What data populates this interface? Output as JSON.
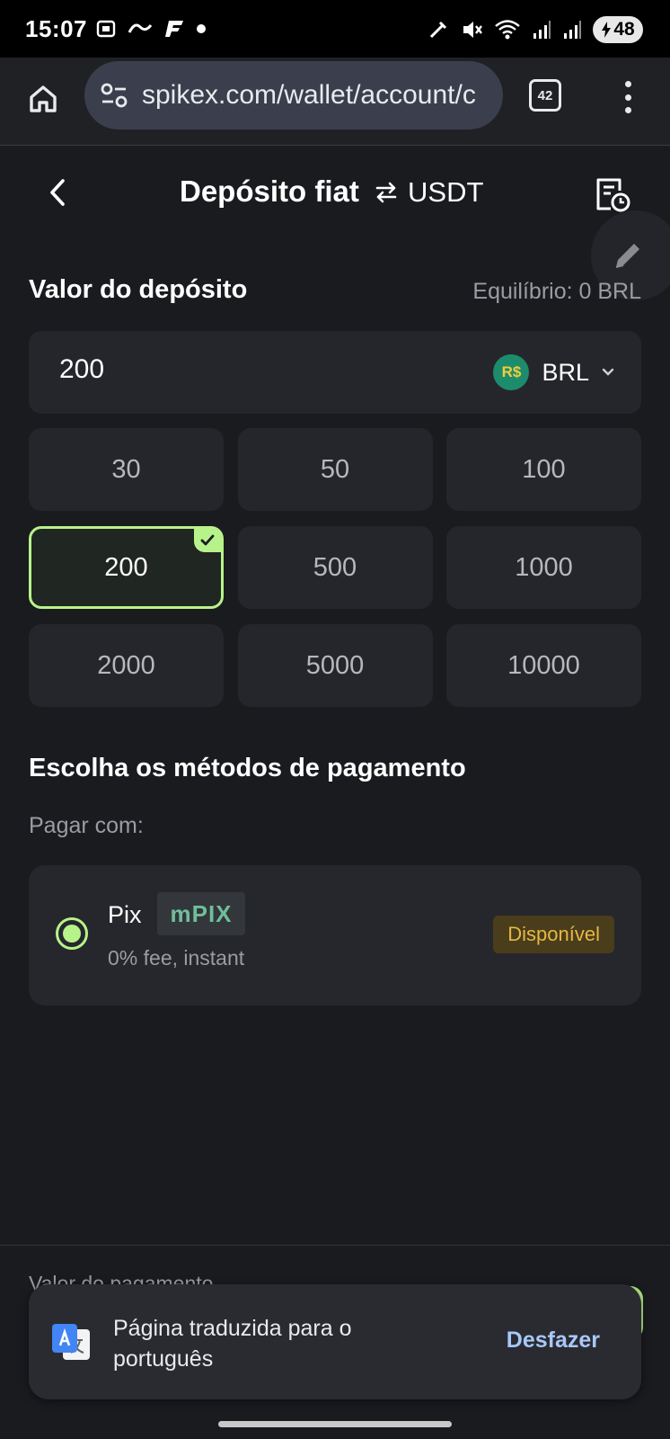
{
  "status_bar": {
    "time": "15:07",
    "battery": "48"
  },
  "browser": {
    "url": "spikex.com/wallet/account/c",
    "tab_count": "42"
  },
  "header": {
    "title": "Depósito fiat",
    "swap_label": "USDT"
  },
  "deposit": {
    "section_title": "Valor do depósito",
    "balance": "Equilíbrio: 0 BRL",
    "amount_value": "200",
    "currency": "BRL",
    "currency_logo_text": "R$",
    "presets": [
      "30",
      "50",
      "100",
      "200",
      "500",
      "1000",
      "2000",
      "5000",
      "10000"
    ],
    "selected_preset": "200"
  },
  "payment": {
    "section_title": "Escolha os métodos de pagamento",
    "pay_with": "Pagar com:",
    "methods": [
      {
        "name": "Pix",
        "logo_text": "mPIX",
        "description": "0% fee, instant",
        "status": "Disponível",
        "selected": true
      }
    ]
  },
  "footer": {
    "pay_value_label": "Valor do pagamento"
  },
  "translate_toast": {
    "message": "Página traduzida para o português",
    "action": "Desfazer"
  },
  "colors": {
    "background": "#1a1b1f",
    "card": "#25262b",
    "accent": "#b8f28a",
    "status_available": "#e6b842",
    "link": "#a8c7fa"
  },
  "icons": {
    "back": "chevron-left-icon",
    "swap": "swap-arrows-icon",
    "history": "order-history-icon",
    "edit": "pencil-icon",
    "dropdown": "chevron-down-icon",
    "check": "check-icon",
    "translate": "google-translate-icon"
  }
}
